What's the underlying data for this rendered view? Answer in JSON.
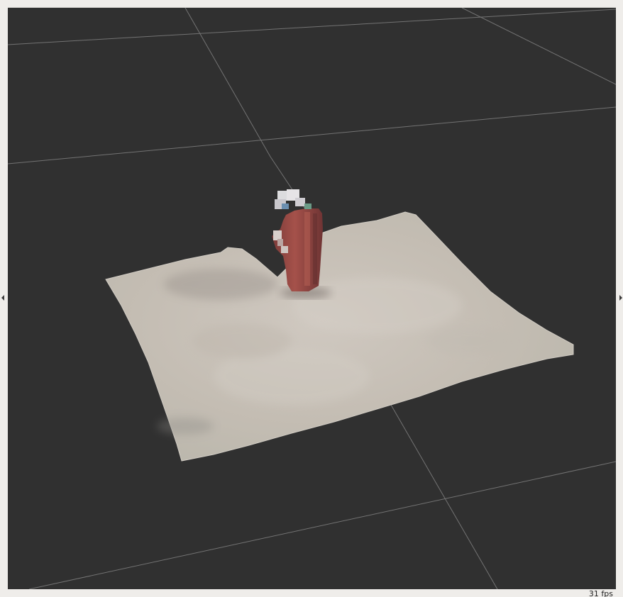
{
  "status_bar": {
    "fps_label": "31 fps"
  },
  "viewport": {
    "background_color": "#303030",
    "grid_color": "#8c8c8c",
    "surface_color": "#c7c1b8",
    "object_color": "#9c4a43"
  },
  "icons": {
    "left_splitter": "triangle-left-icon",
    "right_splitter": "triangle-right-icon"
  }
}
